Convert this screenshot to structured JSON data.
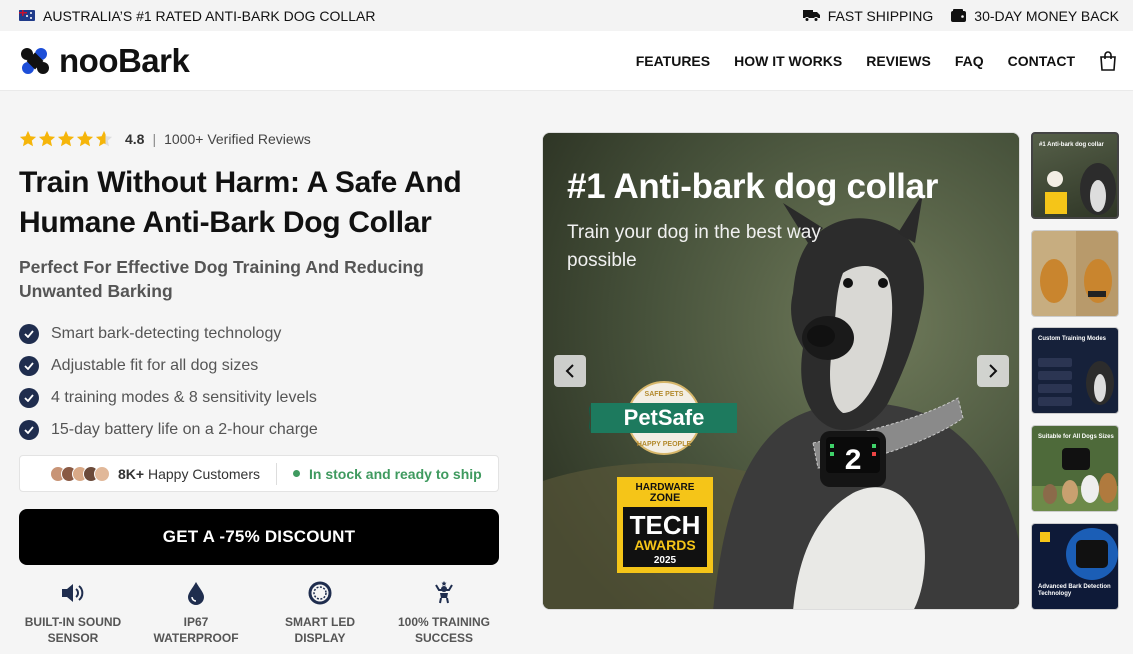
{
  "topbar": {
    "left_text": "AUSTRALIA’S #1 RATED ANTI-BARK DOG COLLAR",
    "shipping": "FAST SHIPPING",
    "money_back": "30-DAY MONEY BACK"
  },
  "brand": {
    "name": "nooBark",
    "accent": "#1d4ed8"
  },
  "nav": {
    "features": "FEATURES",
    "how": "HOW IT WORKS",
    "reviews": "REVIEWS",
    "faq": "FAQ",
    "contact": "CONTACT"
  },
  "product": {
    "rating_value": "4.8",
    "rating_fraction": 0.96,
    "reviews_text": "1000+ Verified Reviews",
    "title": "Train Without Harm: A Safe And Humane Anti-Bark Dog Collar",
    "subtitle": "Perfect For Effective Dog Training And Reducing Unwanted Barking",
    "features": [
      "Smart bark-detecting technology",
      "Adjustable fit for all dog sizes",
      "4 training modes & 8 sensitivity levels",
      "15-day battery life on a 2-hour charge"
    ],
    "happy_count": "8K+",
    "happy_label": "Happy Customers",
    "stock": "In stock and ready to ship",
    "cta": "GET A -75% DISCOUNT"
  },
  "usps": [
    {
      "line1": "BUILT-IN SOUND",
      "line2": "SENSOR",
      "icon": "speaker-icon"
    },
    {
      "line1": "IP67",
      "line2": "WATERPROOF",
      "icon": "water-drop-icon"
    },
    {
      "line1": "SMART LED",
      "line2": "DISPLAY",
      "icon": "led-ring-icon"
    },
    {
      "line1": "100% TRAINING",
      "line2": "SUCCESS",
      "icon": "trophy-person-icon"
    }
  ],
  "gallery": {
    "headline": "#1 Anti-bark dog collar",
    "subline": "Train your dog in the best way possible",
    "petsafe_top": "SAFE PETS",
    "petsafe_main": "PetSafe",
    "petsafe_bottom": "HAPPY PEOPLE",
    "award_line1": "HARDWARE",
    "award_line2": "ZONE",
    "award_tech": "TECH",
    "award_awards": "AWARDS",
    "award_year": "2025",
    "collar_digit": "2",
    "thumbs": [
      "#1 Anti-bark dog collar",
      "",
      "Custom Training Modes",
      "Suitable for All Dogs Sizes",
      "Advanced Bark Detection Technology"
    ]
  }
}
